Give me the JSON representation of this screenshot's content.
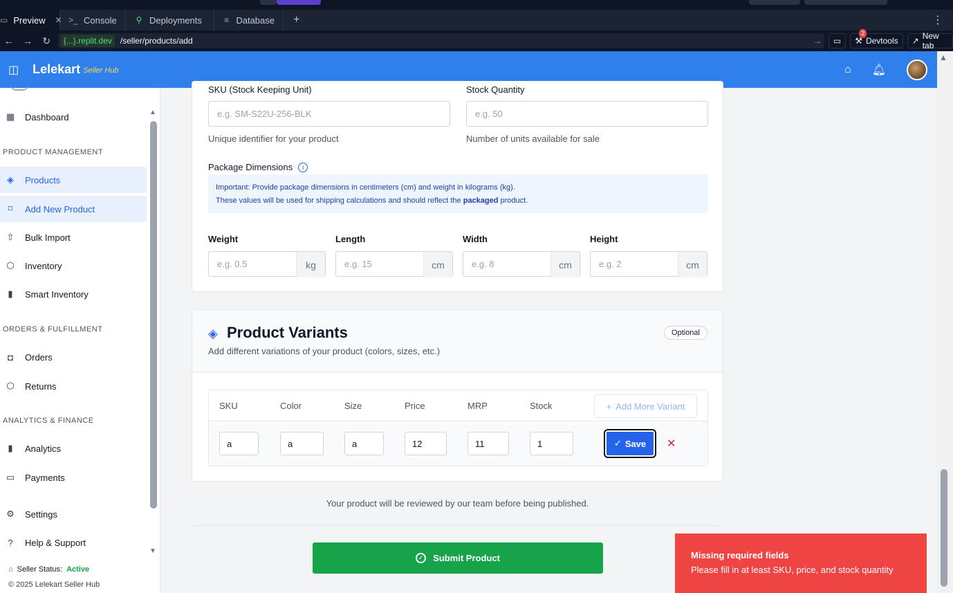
{
  "replit": {
    "tabs": [
      {
        "label": "Preview",
        "icon": "monitor-icon"
      },
      {
        "label": "Console",
        "icon": "terminal-icon"
      },
      {
        "label": "Deployments",
        "icon": "deploy-icon"
      },
      {
        "label": "Database",
        "icon": "database-icon"
      }
    ],
    "domain": "{...}.replit.dev",
    "path": "/seller/products/add",
    "devtools_label": "Devtools",
    "devtools_badge": "2",
    "newtab_label": "New tab"
  },
  "header": {
    "brand": "Lelekart",
    "hub": "Seller Hub"
  },
  "sidebar": {
    "items": [
      {
        "label": "Dashboard",
        "icon": "grid-icon"
      },
      {
        "label": "Products",
        "icon": "layers-icon"
      },
      {
        "label": "Add New Product",
        "icon": "bookmark-icon"
      },
      {
        "label": "Bulk Import",
        "icon": "upload-icon"
      },
      {
        "label": "Inventory",
        "icon": "box-icon"
      },
      {
        "label": "Smart Inventory",
        "icon": "bar-chart-icon"
      },
      {
        "label": "Orders",
        "icon": "bag-icon"
      },
      {
        "label": "Returns",
        "icon": "return-icon"
      },
      {
        "label": "Analytics",
        "icon": "bar-chart-icon"
      },
      {
        "label": "Payments",
        "icon": "credit-card-icon"
      },
      {
        "label": "Settings",
        "icon": "gear-icon"
      },
      {
        "label": "Help & Support",
        "icon": "help-icon"
      }
    ],
    "sections": [
      "PRODUCT MANAGEMENT",
      "ORDERS & FULFILLMENT",
      "ANALYTICS & FINANCE"
    ],
    "seller_status_label": "Seller Status:",
    "seller_status_value": "Active",
    "copyright": "© 2025 Lelekart Seller Hub"
  },
  "inventory": {
    "sku_label": "SKU (Stock Keeping Unit)",
    "sku_placeholder": "e.g. SM-S22U-256-BLK",
    "sku_help": "Unique identifier for your product",
    "stock_label": "Stock Quantity",
    "stock_placeholder": "e.g. 50",
    "stock_help": "Number of units available for sale"
  },
  "package": {
    "title": "Package Dimensions",
    "info_line1": "Important: Provide package dimensions in centimeters (cm) and weight in kilograms (kg).",
    "info_line2_pre": "These values will be used for shipping calculations and should reflect the ",
    "info_line2_bold": "packaged",
    "info_line2_post": " product.",
    "fields": [
      {
        "label": "Weight",
        "placeholder": "e.g. 0.5",
        "unit": "kg"
      },
      {
        "label": "Length",
        "placeholder": "e.g. 15",
        "unit": "cm"
      },
      {
        "label": "Width",
        "placeholder": "e.g. 8",
        "unit": "cm"
      },
      {
        "label": "Height",
        "placeholder": "e.g. 2",
        "unit": "cm"
      }
    ]
  },
  "variants": {
    "title": "Product Variants",
    "subtitle": "Add different variations of your product (colors, sizes, etc.)",
    "optional": "Optional",
    "columns": [
      "SKU",
      "Color",
      "Size",
      "Price",
      "MRP",
      "Stock"
    ],
    "add_more": "Add More Variant",
    "row": {
      "sku": "a",
      "color": "a",
      "size": "a",
      "price": "12",
      "mrp": "11",
      "stock": "1"
    },
    "save": "Save"
  },
  "footer": {
    "review_note": "Your product will be reviewed by our team before being published.",
    "submit": "Submit Product"
  },
  "toast": {
    "title": "Missing required fields",
    "message": "Please fill in at least SKU, price, and stock quantity"
  }
}
